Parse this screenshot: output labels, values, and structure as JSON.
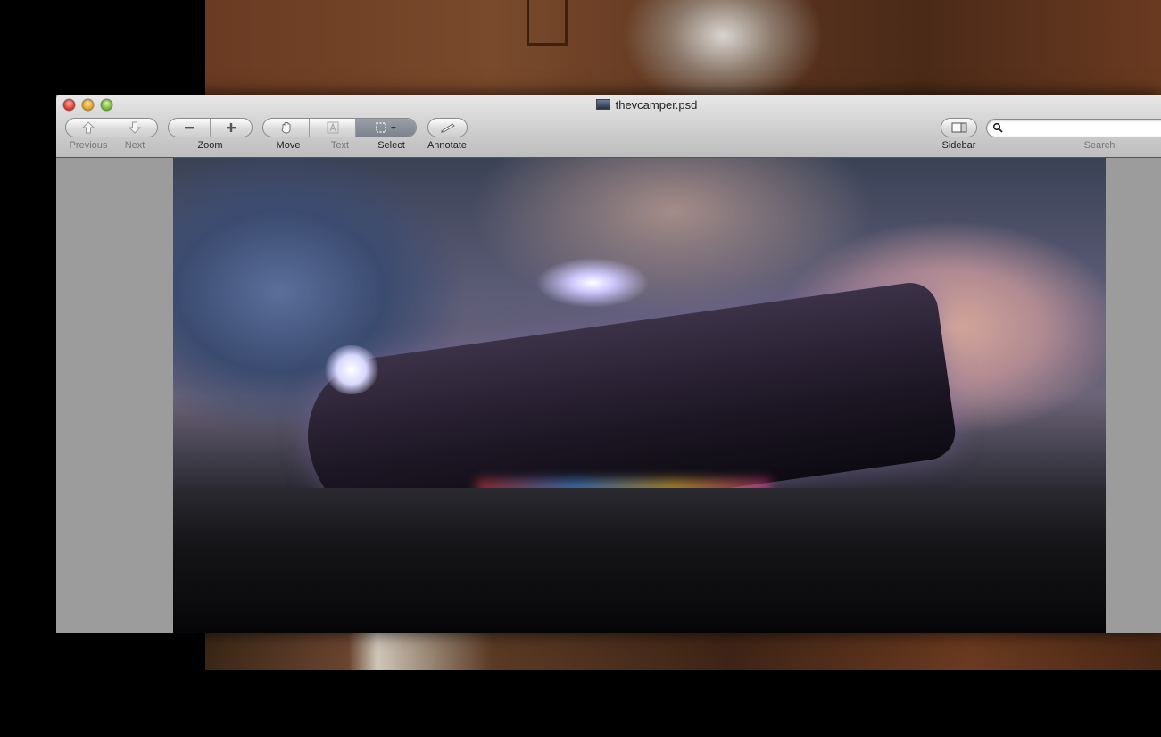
{
  "window": {
    "title": "thevcamper.psd"
  },
  "toolbar": {
    "previous_label": "Previous",
    "next_label": "Next",
    "zoom_label": "Zoom",
    "move_label": "Move",
    "text_label": "Text",
    "select_label": "Select",
    "annotate_label": "Annotate",
    "sidebar_label": "Sidebar",
    "search_label": "Search",
    "search_value": ""
  },
  "icons": {
    "previous": "arrow-up-icon",
    "next": "arrow-down-icon",
    "zoom_out": "minus-icon",
    "zoom_in": "plus-icon",
    "move": "hand-icon",
    "text": "text-tool-icon",
    "select": "marquee-select-icon",
    "annotate": "pencil-icon",
    "sidebar": "sidebar-icon",
    "search": "magnifier-icon"
  },
  "colors": {
    "select_active": "#7c828c",
    "close": "#e0443a",
    "minimize": "#e3a72a",
    "zoom": "#7cbf3a"
  }
}
